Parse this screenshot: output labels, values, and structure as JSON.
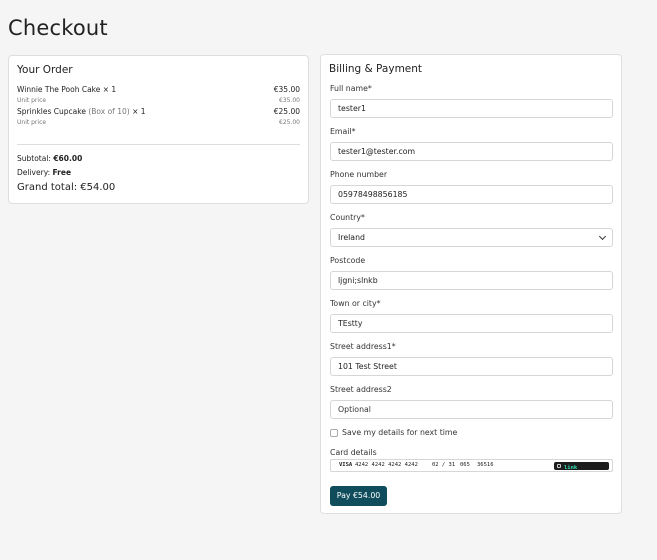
{
  "page": {
    "title": "Checkout"
  },
  "order": {
    "title": "Your Order",
    "items": [
      {
        "name": "Winnie The Pooh Cake",
        "qty": "× 1",
        "price": "€35.00",
        "unit_label": "Unit price",
        "unit_price": "€35.00"
      },
      {
        "name": "Sprinkles Cupcake",
        "variant": "(Box of 10)",
        "qty": "× 1",
        "price": "€25.00",
        "unit_label": "Unit price",
        "unit_price": "€25.00"
      }
    ],
    "subtotal_label": "Subtotal:",
    "subtotal": "€60.00",
    "delivery_label": "Delivery:",
    "delivery": "Free",
    "grand_total": "Grand total: €54.00"
  },
  "billing": {
    "title": "Billing & Payment",
    "full_name": {
      "label": "Full name*",
      "value": "tester1"
    },
    "email": {
      "label": "Email*",
      "value": "tester1@tester.com"
    },
    "phone": {
      "label": "Phone number",
      "value": "05978498856185"
    },
    "country": {
      "label": "Country*",
      "value": "Ireland"
    },
    "postcode": {
      "label": "Postcode",
      "value": "ljgni;slnkb"
    },
    "town": {
      "label": "Town or city*",
      "value": "TEstty"
    },
    "street1": {
      "label": "Street address1*",
      "value": "101 Test Street"
    },
    "street2": {
      "label": "Street address2",
      "placeholder": "Optional"
    },
    "save_details": "Save my details for next time",
    "card": {
      "label": "Card details",
      "brand": "VISA",
      "number": "4242 4242 4242 4242",
      "expiry": "02 / 31",
      "cvc": "065",
      "zip": "36516",
      "link_prefix": "Save with",
      "link_brand": "link"
    },
    "pay_label": "Pay €54.00"
  },
  "colors": {
    "pay_button": "#0f4c5c",
    "link_green": "#33ddb3"
  }
}
